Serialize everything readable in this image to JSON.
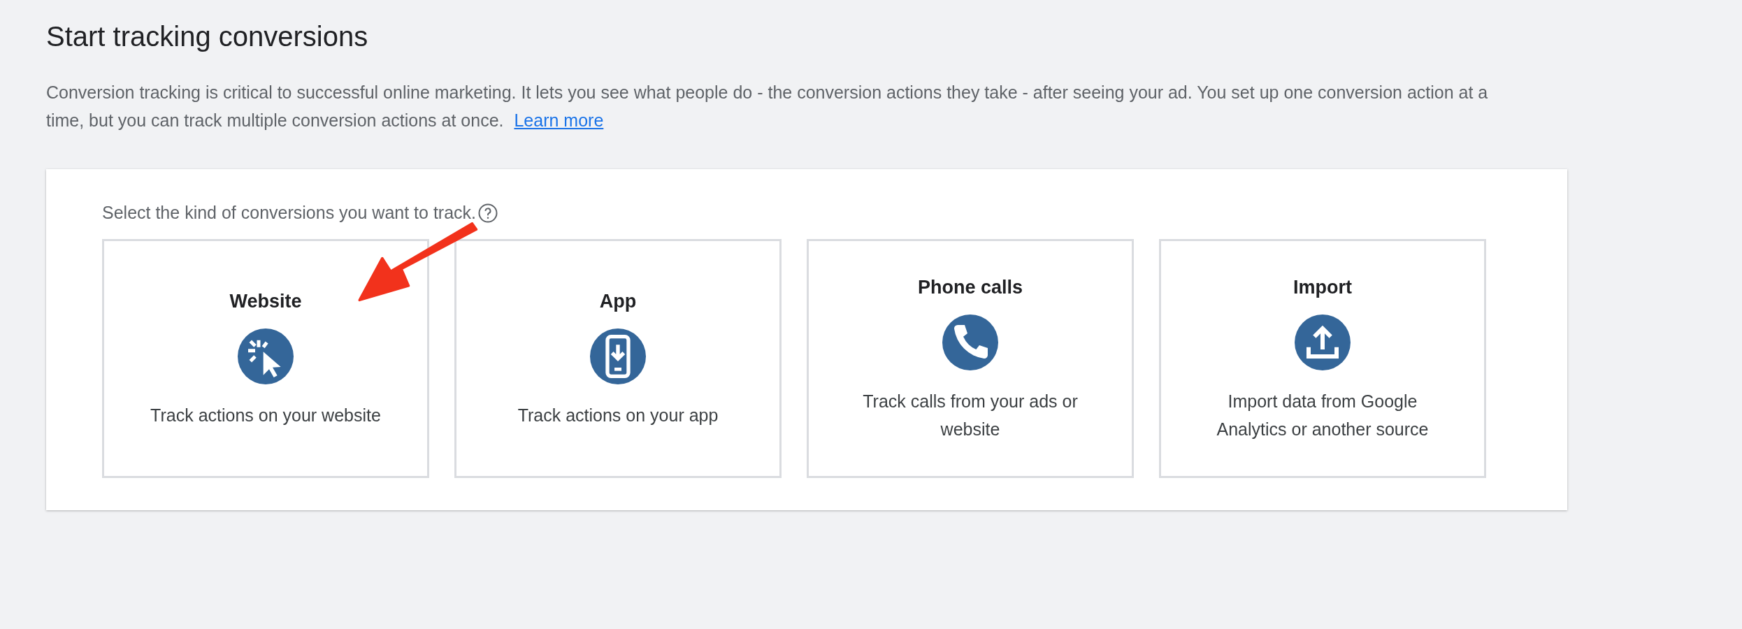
{
  "heading": "Start tracking conversions",
  "intro": {
    "text": "Conversion tracking is critical to successful online marketing. It lets you see what people do - the conversion actions they take - after seeing your ad. You set up one conversion action at a time, but you can track multiple conversion actions at once.",
    "link": "Learn more"
  },
  "prompt": "Select the kind of conversions you want to track.",
  "options": [
    {
      "kind": "website",
      "title": "Website",
      "description": "Track actions on your website"
    },
    {
      "kind": "app",
      "title": "App",
      "description": "Track actions on your app"
    },
    {
      "kind": "phone",
      "title": "Phone calls",
      "description": "Track calls from your ads or website"
    },
    {
      "kind": "import",
      "title": "Import",
      "description": "Import data from Google Analytics or another source"
    }
  ]
}
